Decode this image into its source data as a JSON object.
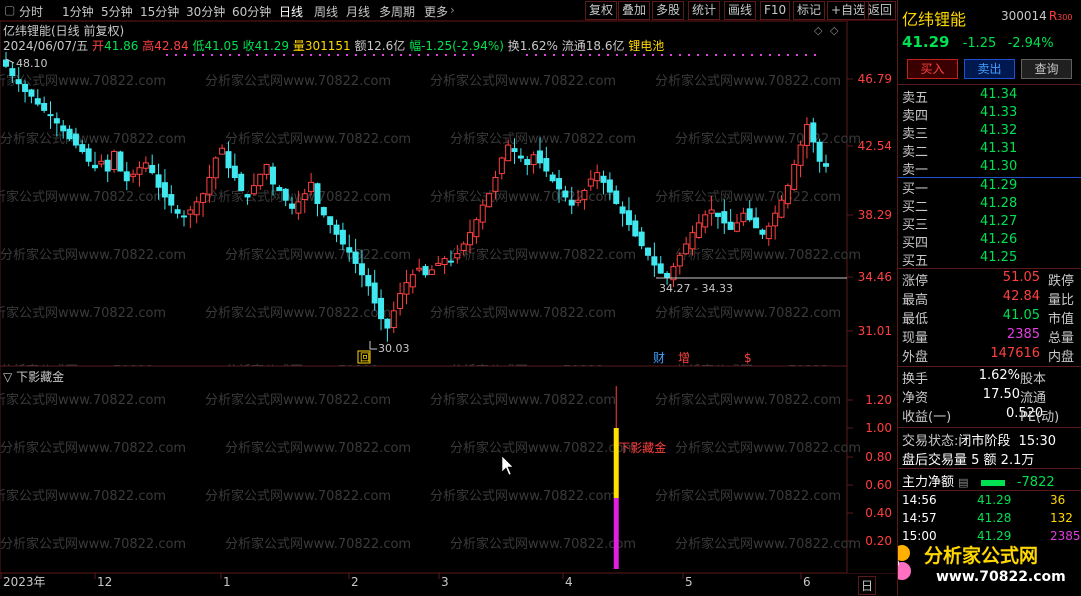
{
  "toolbar": {
    "periods": [
      "分时",
      "1分钟",
      "5分钟",
      "15分钟",
      "30分钟",
      "60分钟",
      "日线",
      "周线",
      "月线",
      "多周期",
      "更多"
    ],
    "active_period": "日线",
    "buttons": [
      "复权",
      "叠加",
      "多股",
      "统计",
      "画线",
      "F10",
      "标记",
      "+自选",
      "返回"
    ]
  },
  "chart": {
    "title": "亿纬锂能(日线 前复权)",
    "date": "2024/06/07/五",
    "open_label": "开",
    "open": "41.86",
    "high_label": "高",
    "high": "42.84",
    "low_label": "低",
    "low": "41.05",
    "close_label": "收",
    "close": "41.29",
    "vol_label": "量",
    "vol": "301151",
    "amount": "额12.6亿",
    "change": "幅-1.25(-2.94%)",
    "turnover": "换1.62%",
    "float_cap": "流通18.6亿",
    "sector": "锂电池",
    "y_ticks": [
      "46.79",
      "42.54",
      "38.29",
      "34.46",
      "31.01"
    ],
    "max_label": "48.10",
    "min_label": "30.03",
    "range_label": "34.27 - 34.33",
    "markers": [
      "财",
      "增",
      "$"
    ],
    "marker_box": "回",
    "watermark": "分析家公式网www.70822.com"
  },
  "indicator": {
    "name": "下影藏金",
    "signal_text": "下影藏金",
    "y_ticks": [
      "1.20",
      "1.00",
      "0.80",
      "0.60",
      "0.40",
      "0.20"
    ],
    "signal": {
      "date_index": 96,
      "value": 1.0
    }
  },
  "xaxis": {
    "labels": [
      "2023年",
      "12",
      "1",
      "2",
      "3",
      "4",
      "5",
      "6"
    ],
    "unit": "日"
  },
  "stock": {
    "name": "亿纬锂能",
    "code": "300014",
    "tag": "R",
    "tag_sub": "300",
    "price": "41.29",
    "change": "-1.25",
    "change_pct": "-2.94%",
    "btn_buy": "买入",
    "btn_sell": "卖出",
    "btn_query": "查询"
  },
  "orderbook": {
    "asks": [
      {
        "label": "卖五",
        "price": "41.34"
      },
      {
        "label": "卖四",
        "price": "41.33"
      },
      {
        "label": "卖三",
        "price": "41.32"
      },
      {
        "label": "卖二",
        "price": "41.31"
      },
      {
        "label": "卖一",
        "price": "41.30"
      }
    ],
    "bids": [
      {
        "label": "买一",
        "price": "41.29"
      },
      {
        "label": "买二",
        "price": "41.28"
      },
      {
        "label": "买三",
        "price": "41.27"
      },
      {
        "label": "买四",
        "price": "41.26"
      },
      {
        "label": "买五",
        "price": "41.25"
      }
    ]
  },
  "stats": [
    {
      "label": "涨停",
      "value": "51.05",
      "cls": "r",
      "right": "跌停"
    },
    {
      "label": "最高",
      "value": "42.84",
      "cls": "r",
      "right": "量比"
    },
    {
      "label": "最低",
      "value": "41.05",
      "cls": "g",
      "right": "市值"
    },
    {
      "label": "现量",
      "value": "2385",
      "cls": "m",
      "right": "总量"
    },
    {
      "label": "外盘",
      "value": "147616",
      "cls": "r",
      "right": "内盘"
    }
  ],
  "fund": [
    {
      "label": "换手",
      "value": "1.62%",
      "right": "股本"
    },
    {
      "label": "净资",
      "value": "17.50",
      "right": "流通"
    },
    {
      "label": "收益(一)",
      "value": "0.520",
      "right": "PE(动)"
    }
  ],
  "trade_status": {
    "label": "交易状态:",
    "value": "闭市阶段",
    "time": "15:30"
  },
  "after_hours": "盘后交易量 5 额 2.1万",
  "net_flow": {
    "label": "主力净额",
    "value": "-7822"
  },
  "ticks": [
    {
      "time": "14:56",
      "price": "41.29",
      "vol": "36"
    },
    {
      "time": "14:57",
      "price": "41.28",
      "vol": "132"
    },
    {
      "time": "15:00",
      "price": "41.29",
      "vol": "2385"
    }
  ],
  "brand": {
    "name": "分析家公式网",
    "url": "www.70822.com"
  },
  "colors": {
    "up": "#ff4040",
    "down": "#40e8f0",
    "bg": "#000000",
    "grid": "#5a1a1a",
    "accent": "#ffd800"
  }
}
